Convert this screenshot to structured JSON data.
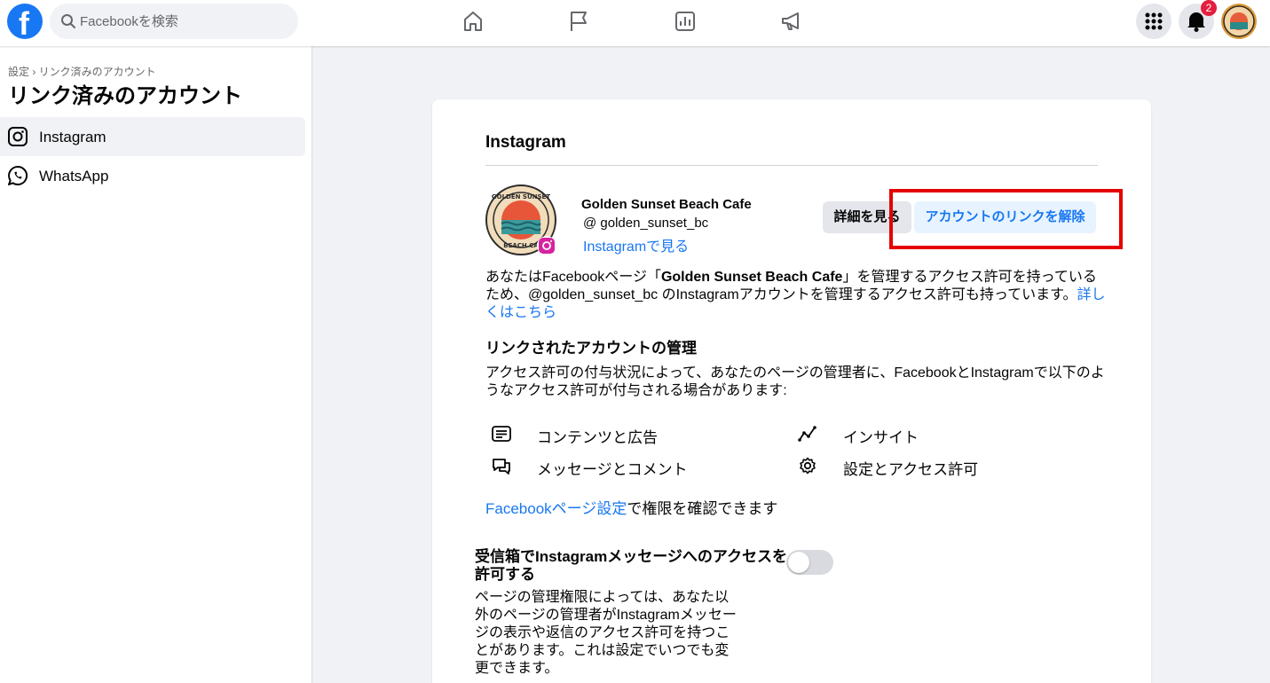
{
  "header": {
    "logo": "f",
    "search_placeholder": "Facebookを検索",
    "nav_icons": [
      "home-icon",
      "flag-icon",
      "insights-icon",
      "megaphone-icon"
    ],
    "notification_count": "2"
  },
  "sidebar": {
    "breadcrumb": "設定 › リンク済みのアカウント",
    "title": "リンク済みのアカウント",
    "items": [
      {
        "label": "Instagram",
        "icon": "instagram-icon",
        "active": true
      },
      {
        "label": "WhatsApp",
        "icon": "whatsapp-icon",
        "active": false
      }
    ]
  },
  "card": {
    "title": "Instagram",
    "account": {
      "name": "Golden Sunset Beach Cafe",
      "handle": "@ golden_sunset_bc",
      "view_link": "Instagramで見る",
      "logo_text_top": "GOLDEN SUNSET",
      "logo_text_bottom": "BEACH CA"
    },
    "buttons": {
      "details": "詳細を見る",
      "unlink": "アカウントのリンクを解除"
    },
    "description": {
      "part1": "あなたはFacebookページ「",
      "page_name": "Golden Sunset Beach Cafe",
      "part2": "」を管理するアクセス許可を持っているため、@golden_sunset_bc のInstagramアカウントを管理するアクセス許可も持っています。",
      "link": "詳しくはこちら"
    },
    "section_title": "リンクされたアカウントの管理",
    "section_desc": "アクセス許可の付与状況によって、あなたのページの管理者に、FacebookとInstagramで以下のようなアクセス許可が付与される場合があります:",
    "permissions": [
      {
        "label": "コンテンツと広告",
        "icon": "content-icon"
      },
      {
        "label": "インサイト",
        "icon": "insights-icon"
      },
      {
        "label": "メッセージとコメント",
        "icon": "messages-icon"
      },
      {
        "label": "設定とアクセス許可",
        "icon": "gear-icon"
      }
    ],
    "settings_link": "Facebookページ設定",
    "settings_suffix": "で権限を確認できます",
    "toggle": {
      "title": "受信箱でInstagramメッセージへのアクセスを許可する",
      "enabled": false,
      "description": "ページの管理権限によっては、あなた以外のページの管理者がInstagramメッセージの表示や返信のアクセス許可を持つことがあります。これは設定でいつでも変更できます。"
    }
  },
  "colors": {
    "brand": "#1877f2",
    "highlight": "#e50000",
    "badge": "#e41e3f"
  }
}
